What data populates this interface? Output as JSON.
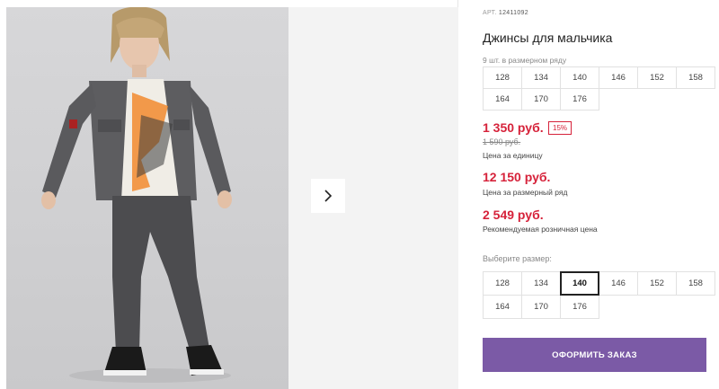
{
  "product": {
    "article_label": "АРТ.",
    "article_value": "12411092",
    "title": "Джинсы для мальчика",
    "size_row_note": "9 шт. в размерном ряду"
  },
  "size_row": [
    "128",
    "134",
    "140",
    "146",
    "152",
    "158",
    "164",
    "170",
    "176"
  ],
  "pricing": {
    "unit_price": "1 350 руб.",
    "discount": "15%",
    "old_price": "1 590 руб.",
    "unit_caption": "Цена за единицу",
    "row_price": "12 150 руб.",
    "row_caption": "Цена за размерный ряд",
    "retail_price": "2 549 руб.",
    "retail_caption": "Рекомендуемая розничная цена"
  },
  "size_select": {
    "label": "Выберите размер:",
    "options": [
      "128",
      "134",
      "140",
      "146",
      "152",
      "158",
      "164",
      "170",
      "176"
    ],
    "selected": "140"
  },
  "order_button": "ОФОРМИТЬ ЗАКАЗ",
  "icons": {
    "next": "chevron-right-icon"
  },
  "colors": {
    "accent": "#7b5aa6",
    "price": "#d6223a"
  }
}
